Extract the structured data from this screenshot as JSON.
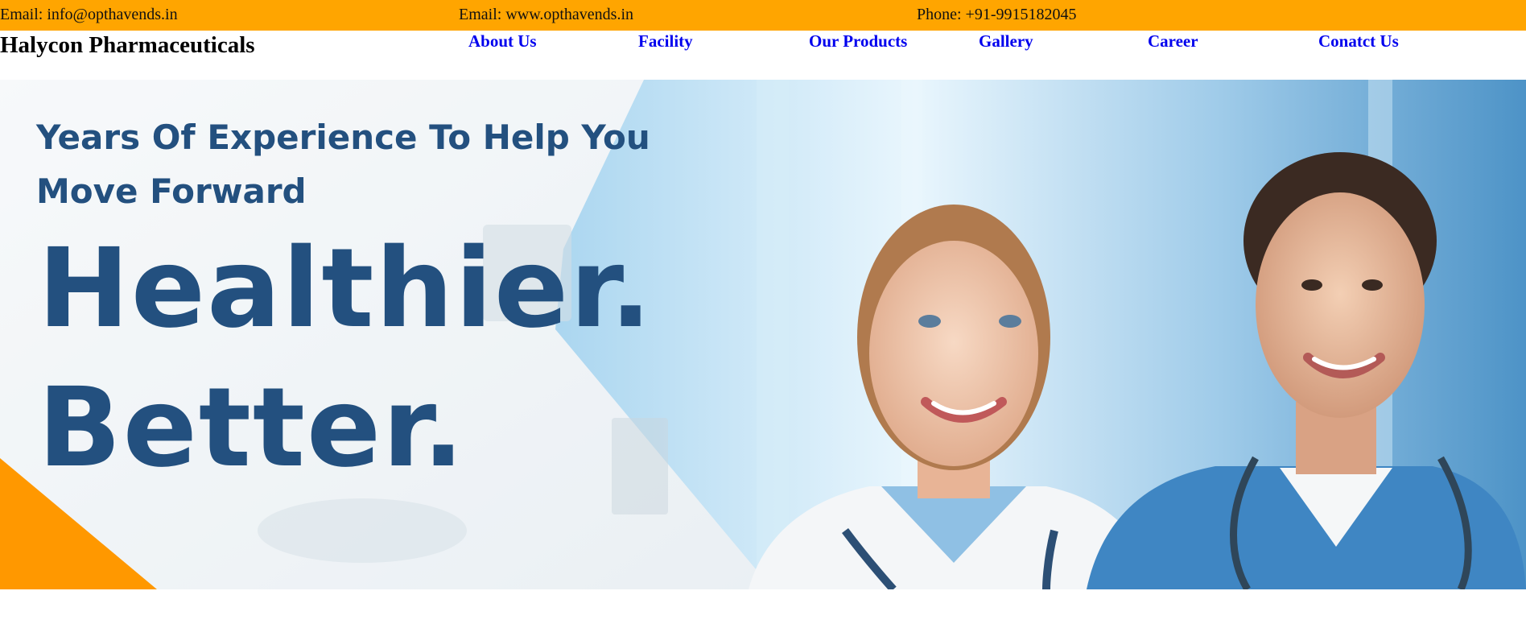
{
  "topbar": {
    "email": "Email: info@opthavends.in",
    "website": "Email: www.opthavends.in",
    "phone": "Phone: +91-9915182045"
  },
  "brand": {
    "name": "Halycon Pharmaceuticals"
  },
  "nav": {
    "items": [
      {
        "label": "About Us"
      },
      {
        "label": "Facility"
      },
      {
        "label": "Our Products"
      },
      {
        "label": "Gallery"
      },
      {
        "label": "Career"
      },
      {
        "label": "Conatct Us"
      }
    ]
  },
  "hero": {
    "tagline_line1": "Years Of Experience To Help You",
    "tagline_line2": "Move Forward",
    "headline_line1": "Healthier.",
    "headline_line2": "Better."
  },
  "colors": {
    "topbar": "#ffa500",
    "link": "#0000ee",
    "hero_text": "#23507f",
    "accent_triangle": "#ff9800"
  }
}
